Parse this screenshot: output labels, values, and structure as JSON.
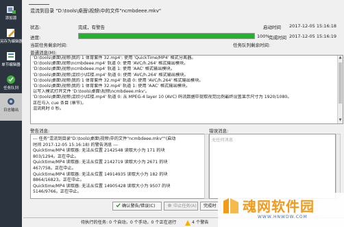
{
  "sidebar": {
    "items": [
      {
        "label": "添加源",
        "icon": "add-source-icon"
      },
      {
        "label": "另存为编辑器",
        "icon": "edit-icon"
      },
      {
        "label": "单节编辑器",
        "icon": "section-editor-icon"
      },
      {
        "label": "任务队列",
        "icon": "queue-icon"
      },
      {
        "label": "日志输出",
        "icon": "gear-icon"
      }
    ]
  },
  "header": {
    "title": "混流到目录 \"D:\\tools\\桌面\\视频\\中的文件\"ncmbdeee.mkv\""
  },
  "status": {
    "label": "状态:",
    "value": "完成，有警告",
    "start_label": "启动时间",
    "start_time": "2017-12-05 15:16:18",
    "progress_label": "进度:",
    "progress_value": 100,
    "progress_text": "100%",
    "finish_label": "完成时间",
    "finish_time": "2017-12-05 15:16:19",
    "current_task_progress_label": "当前任务剩余时间:",
    "total_progress_label": "任务队列剩余时间:"
  },
  "log": {
    "label": "普通消息(M):",
    "lines": [
      "'D:\\tools\\桌面\\视频\\我的 1 体育套件 32.mp4': 使用 'QuickTime/MP4' 格式分离器。",
      "'D:\\tools\\桌面\\视频\\ncmbdeee.mp4' 轨道 0: 使用 'AVC/h.264' 格式输出模块。",
      "'D:\\tools\\桌面\\视频\\ncmbdeee.mp4' 轨道 1: 使用 'AAC' 格式输出模块。",
      "'D:\\tools\\桌面\\视频\\混欣小\\红楼.mp4' 轨道 0: 使用 'AVC/h.264' 格式输出模块。",
      "'D:\\tools\\桌面\\视频\\我的 1 体育套件 32.mp4' 轨道 0: 使用 'AVC/h.264' 格式输出模块。",
      "'D:\\tools\\桌面\\视频\\我的 1 体育套件 32.mp4' 轨道 1: 使用 'AAC' 格式输出模块。",
      "以写入模式打开文件 'D:\\tools\\桌面\\视频\\ncmbdeee.mkv'。",
      "'D:\\tools\\桌面\\视频\\混欣小\\红楼.mp4' 轨道 0: 从 MPEG-4 layer 10 (AVC) 码流数据中提取视觉比例最终设置显示尺寸为 1920/1080。",
      "正在与入 cue 条目 (章节)。",
      "混流耗时 0 秒。"
    ]
  },
  "warnings": {
    "label": "警告消息:",
    "lines": [
      "--- 任务\"混流到目录\"D:\\tools\\桌面\\视频\\中的文件\"ncmbdeee.mkv\"\"(启动",
      "时间 2017-12-05 15:16:18) 的警告消息 ---",
      "Quicktime/MP4 读取器: 无法从位置 2142548 读取大小为 171 的块",
      "803/1294。正在中止。",
      "Quicktime/MP4 读取器: 无法从位置 2142719 读取大小为 2671 的块",
      "467/758。正在中止。",
      "Quicktime/MP4 读取器: 无法从位置 14914935 读取大小为 182 的块",
      "8864/16823。正在中止。",
      "Quicktime/MP4 读取器: 无法从位置 14905428 读取大小为 9507 的块",
      "5146/9766。正在中止。"
    ]
  },
  "errors": {
    "label": "错误消息:",
    "placeholder": "无任何消息"
  },
  "buttons": {
    "acknowledge": "确认警告/错误(C)",
    "stop": "中止任务(A)",
    "close": "完成时"
  },
  "statusbar": {
    "text": "待执行的任务: 0 个自动，0 个手动，0 个正在运行",
    "warnings": "4 个警告"
  },
  "watermark": {
    "title": "魂网软件园",
    "url": "WWW.HNWDW.COM"
  },
  "colors": {
    "sidebar_bg": "#2c3440",
    "progress_fill": "#1fb52b",
    "watermark": "#f39a19"
  }
}
